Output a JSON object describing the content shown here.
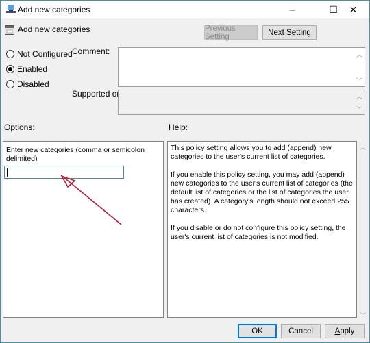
{
  "window": {
    "title": "Add new categories",
    "controls": {
      "minimize": "–",
      "maximize": "☐",
      "close": "✕"
    }
  },
  "header": {
    "setting_title": "Add new categories",
    "previous_label": "Previous Setting",
    "next_label_prefix": "",
    "next_label_accel": "N",
    "next_label_rest": "ext Setting"
  },
  "state_options": [
    {
      "pre": "Not ",
      "accel": "C",
      "post": "onfigured",
      "checked": false
    },
    {
      "pre": "",
      "accel": "E",
      "post": "nabled",
      "checked": true
    },
    {
      "pre": "",
      "accel": "D",
      "post": "isabled",
      "checked": false
    }
  ],
  "fields": {
    "comment_label": "Comment:",
    "comment_value": "",
    "supported_label": "Supported on:",
    "supported_value": ""
  },
  "options": {
    "label": "Options:",
    "input_label": "Enter new categories (comma or semicolon delimited)",
    "input_value": ""
  },
  "help": {
    "label": "Help:",
    "paragraphs": [
      "This policy setting allows you to add (append) new categories to the user's current list of categories.",
      "If you enable this policy setting, you may add (append) new categories to the user's current list of categories (the default list of categories or the list of categories the user has created).  A category's length should not exceed 255 characters.",
      "If you disable or do not configure this policy setting, the user's current list of categories is not modified."
    ]
  },
  "footer": {
    "ok_label": "OK",
    "cancel_label": "Cancel",
    "apply_accel": "A",
    "apply_rest": "pply"
  },
  "annotation": {
    "arrow_color": "#b0203a"
  }
}
